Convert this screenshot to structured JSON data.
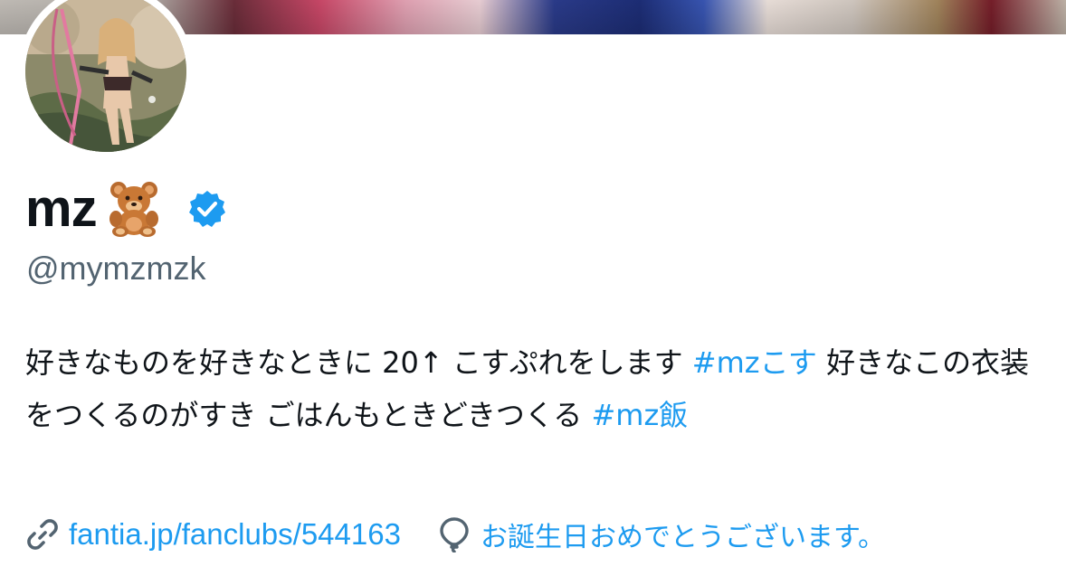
{
  "profile": {
    "display_name": "mz",
    "handle": "@mymzmzk",
    "verified": true,
    "bio": {
      "part1": "好きなものを好きなときに 20↑ こすぷれをします ",
      "tag1": "#mzこす",
      "part2": " 好きなこの衣装をつくるのがすき ごはんもときどきつくる ",
      "tag2": "#mz飯"
    },
    "link": "fantia.jp/fanclubs/544163",
    "birthday": "お誕生日おめでとうございます。"
  },
  "icons": {
    "name_emoji": "teddy-bear-icon",
    "verified": "verified-badge-icon",
    "link": "link-icon",
    "birthday": "balloon-icon"
  },
  "colors": {
    "accent": "#1d9bf0",
    "text": "#0f1419",
    "secondary": "#536471"
  }
}
